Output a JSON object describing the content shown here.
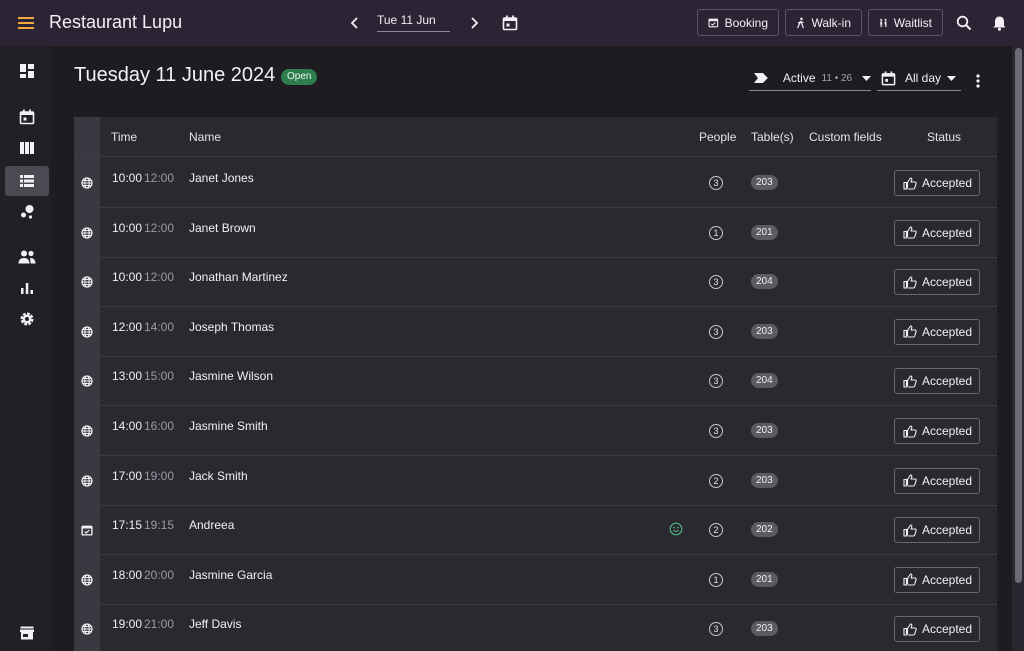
{
  "header": {
    "app_title": "Restaurant Lupu",
    "date_label": "Tue 11 Jun",
    "buttons": {
      "booking": "Booking",
      "walkin": "Walk-in",
      "waitlist": "Waitlist"
    }
  },
  "page": {
    "title": "Tuesday 11 June 2024",
    "status": "Open",
    "filter_active_label": "Active",
    "filter_active_counts": "11 • 26",
    "filter_time_label": "All day"
  },
  "table": {
    "columns": [
      "Time",
      "Name",
      "People",
      "Table(s)",
      "Custom fields",
      "Status"
    ],
    "rows": [
      {
        "source": "web",
        "start": "10:00",
        "end": "12:00",
        "name": "Janet Jones",
        "people": "3",
        "table": "203",
        "status": "Accepted"
      },
      {
        "source": "web",
        "start": "10:00",
        "end": "12:00",
        "name": "Janet Brown",
        "people": "1",
        "table": "201",
        "status": "Accepted"
      },
      {
        "source": "web",
        "start": "10:00",
        "end": "12:00",
        "name": "Jonathan Martinez",
        "people": "3",
        "table": "204",
        "status": "Accepted"
      },
      {
        "source": "web",
        "start": "12:00",
        "end": "14:00",
        "name": "Joseph Thomas",
        "people": "3",
        "table": "203",
        "status": "Accepted"
      },
      {
        "source": "web",
        "start": "13:00",
        "end": "15:00",
        "name": "Jasmine Wilson",
        "people": "3",
        "table": "204",
        "status": "Accepted"
      },
      {
        "source": "web",
        "start": "14:00",
        "end": "16:00",
        "name": "Jasmine Smith",
        "people": "3",
        "table": "203",
        "status": "Accepted"
      },
      {
        "source": "web",
        "start": "17:00",
        "end": "19:00",
        "name": "Jack Smith",
        "people": "2",
        "table": "203",
        "status": "Accepted"
      },
      {
        "source": "calendar",
        "start": "17:15",
        "end": "19:15",
        "name": "Andreea",
        "people": "2",
        "table": "202",
        "status": "Accepted",
        "smiley": true
      },
      {
        "source": "web",
        "start": "18:00",
        "end": "20:00",
        "name": "Jasmine Garcia",
        "people": "1",
        "table": "201",
        "status": "Accepted"
      },
      {
        "source": "web",
        "start": "19:00",
        "end": "21:00",
        "name": "Jeff Davis",
        "people": "3",
        "table": "203",
        "status": "Accepted"
      }
    ]
  },
  "colors": {
    "topbar": "#2c2335",
    "accent": "#f0a93b",
    "open_badge": "#2e7d4f",
    "smiley": "#4caf78"
  }
}
